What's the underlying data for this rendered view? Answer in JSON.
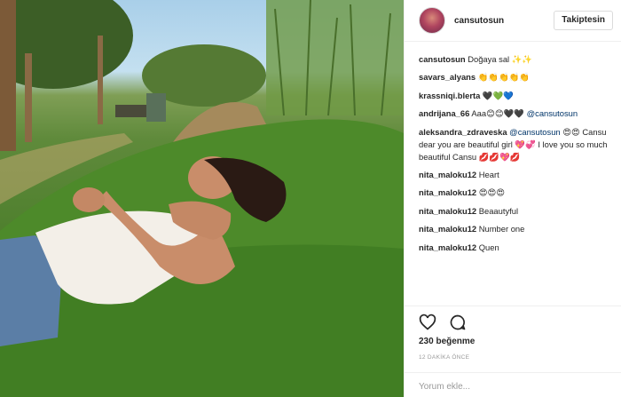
{
  "post": {
    "username": "cansutosun",
    "follow_label": "Takiptesin",
    "likes": "230 beğenme",
    "time": "12 DAKİKA ÖNCE",
    "comment_placeholder": "Yorum ekle..."
  },
  "comments": [
    {
      "author": "cansutosun",
      "text": "Doğaya sal ✨✨"
    },
    {
      "author": "savars_alyans",
      "text": "👏👏👏👏👏"
    },
    {
      "author": "krassniqi.blerta",
      "text": "🖤💚💙"
    },
    {
      "author": "andrijana_66",
      "text": "Aaa😊😊🖤🖤",
      "mention": "@cansutosun"
    },
    {
      "author": "aleksandra_zdraveska",
      "mention": "@cansutosun",
      "text": "😍😍 Cansu dear you are beautiful girl 💖💞 I love you so much beautiful Cansu 💋💋💖💋"
    },
    {
      "author": "nita_maloku12",
      "text": "Heart"
    },
    {
      "author": "nita_maloku12",
      "text": "😍😍😍"
    },
    {
      "author": "nita_maloku12",
      "text": "Beaautyful"
    },
    {
      "author": "nita_maloku12",
      "text": "Number one"
    },
    {
      "author": "nita_maloku12",
      "text": "Quen"
    }
  ],
  "icons": {
    "like": "heart-icon",
    "comment": "comment-bubble-icon",
    "avatar": "profile-avatar"
  },
  "colors": {
    "text": "#262626",
    "muted": "#999999",
    "border": "#efefef",
    "mention": "#003569"
  }
}
